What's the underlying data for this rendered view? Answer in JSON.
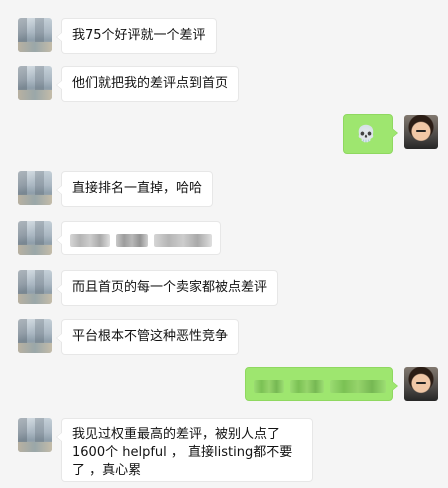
{
  "messages": [
    {
      "side": "left",
      "text": "我75个好评就一个差评"
    },
    {
      "side": "left",
      "text": "他们就把我的差评点到首页"
    },
    {
      "side": "right",
      "emoji": "💀"
    },
    {
      "side": "left",
      "text": "直接排名一直掉，哈哈"
    },
    {
      "side": "left",
      "blurred": true
    },
    {
      "side": "left",
      "text": "而且首页的每一个卖家都被点差评"
    },
    {
      "side": "left",
      "text": "平台根本不管这种恶性竞争"
    },
    {
      "side": "right",
      "blurred": true
    },
    {
      "side": "left",
      "text": "我见过权重最高的差评，被别人点了1600个 helpful ， 直接listing都不要了 ，真心累"
    }
  ],
  "colors": {
    "chat_bg": "#f5f5f5",
    "left_bubble": "#ffffff",
    "right_bubble": "#9ee66f"
  },
  "icons": {
    "right_emoji": "skull-icon"
  }
}
